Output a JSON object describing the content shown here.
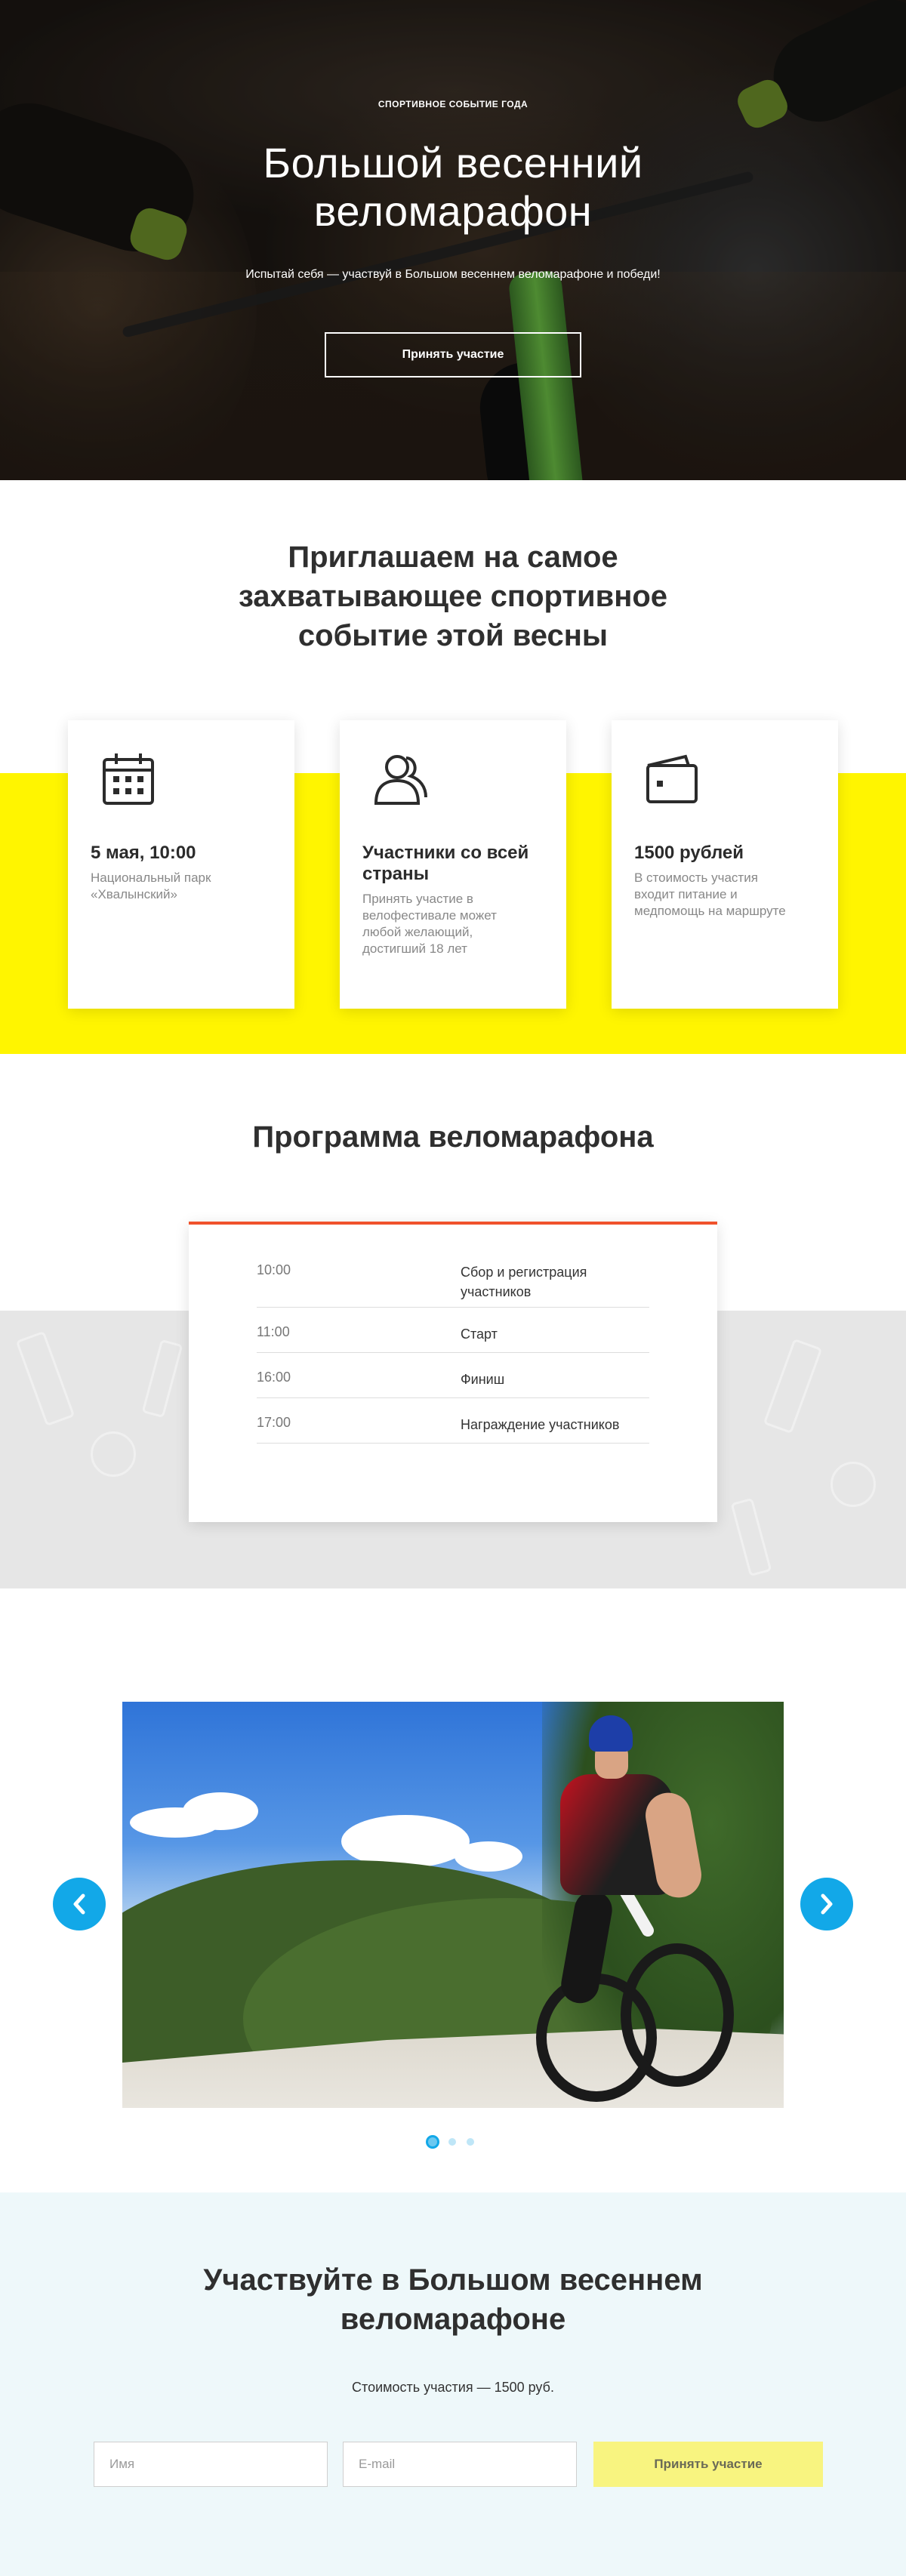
{
  "hero": {
    "kicker": "СПОРТИВНОЕ СОБЫТИЕ ГОДА",
    "title_line1": "Большой весенний",
    "title_line2": "веломарафон",
    "subtitle": "Испытай себя — участвуй в Большом весеннем веломарафоне и победи!",
    "cta_label": "Принять участие"
  },
  "invite": {
    "title_line1": "Приглашаем на самое",
    "title_line2": "захватывающее спортивное",
    "title_line3": "событие этой весны",
    "accent_color": "#fff500",
    "cards": [
      {
        "icon": "calendar-icon",
        "title": "5 мая, 10:00",
        "text_line1": "Национальный парк",
        "text_line2": "«Хвалынский»"
      },
      {
        "icon": "participants-icon",
        "title_line1": "Участники со всей",
        "title_line2": "страны",
        "text_line1": "Принять участие в",
        "text_line2": "велофестивале может",
        "text_line3": "любой желающий,",
        "text_line4": "достигший 18 лет"
      },
      {
        "icon": "wallet-icon",
        "title": "1500 рублей",
        "text_line1": "В стоимость участия",
        "text_line2": "входит питание и",
        "text_line3": "медпомощь на маршруте"
      }
    ]
  },
  "program": {
    "title": "Программа веломарафона",
    "accent_color": "#f0522c",
    "rows": [
      {
        "time": "10:00",
        "event_line1": "Сбор и регистрация",
        "event_line2": "участников"
      },
      {
        "time": "11:00",
        "event_line1": "Старт"
      },
      {
        "time": "16:00",
        "event_line1": "Финиш"
      },
      {
        "time": "17:00",
        "event_line1": "Награждение участников"
      }
    ]
  },
  "slider": {
    "prev_icon": "chevron-left-icon",
    "next_icon": "chevron-right-icon",
    "accent_color": "#12a8e8",
    "slide_count": 3,
    "active_slide": 1
  },
  "signup": {
    "title_line1": "Участвуйте в Большом весеннем",
    "title_line2": "веломарафоне",
    "price_text": "Стоимость участия — 1500 руб.",
    "name_placeholder": "Имя",
    "email_placeholder": "E-mail",
    "submit_label": "Принять участие",
    "button_color": "#f8f480"
  }
}
